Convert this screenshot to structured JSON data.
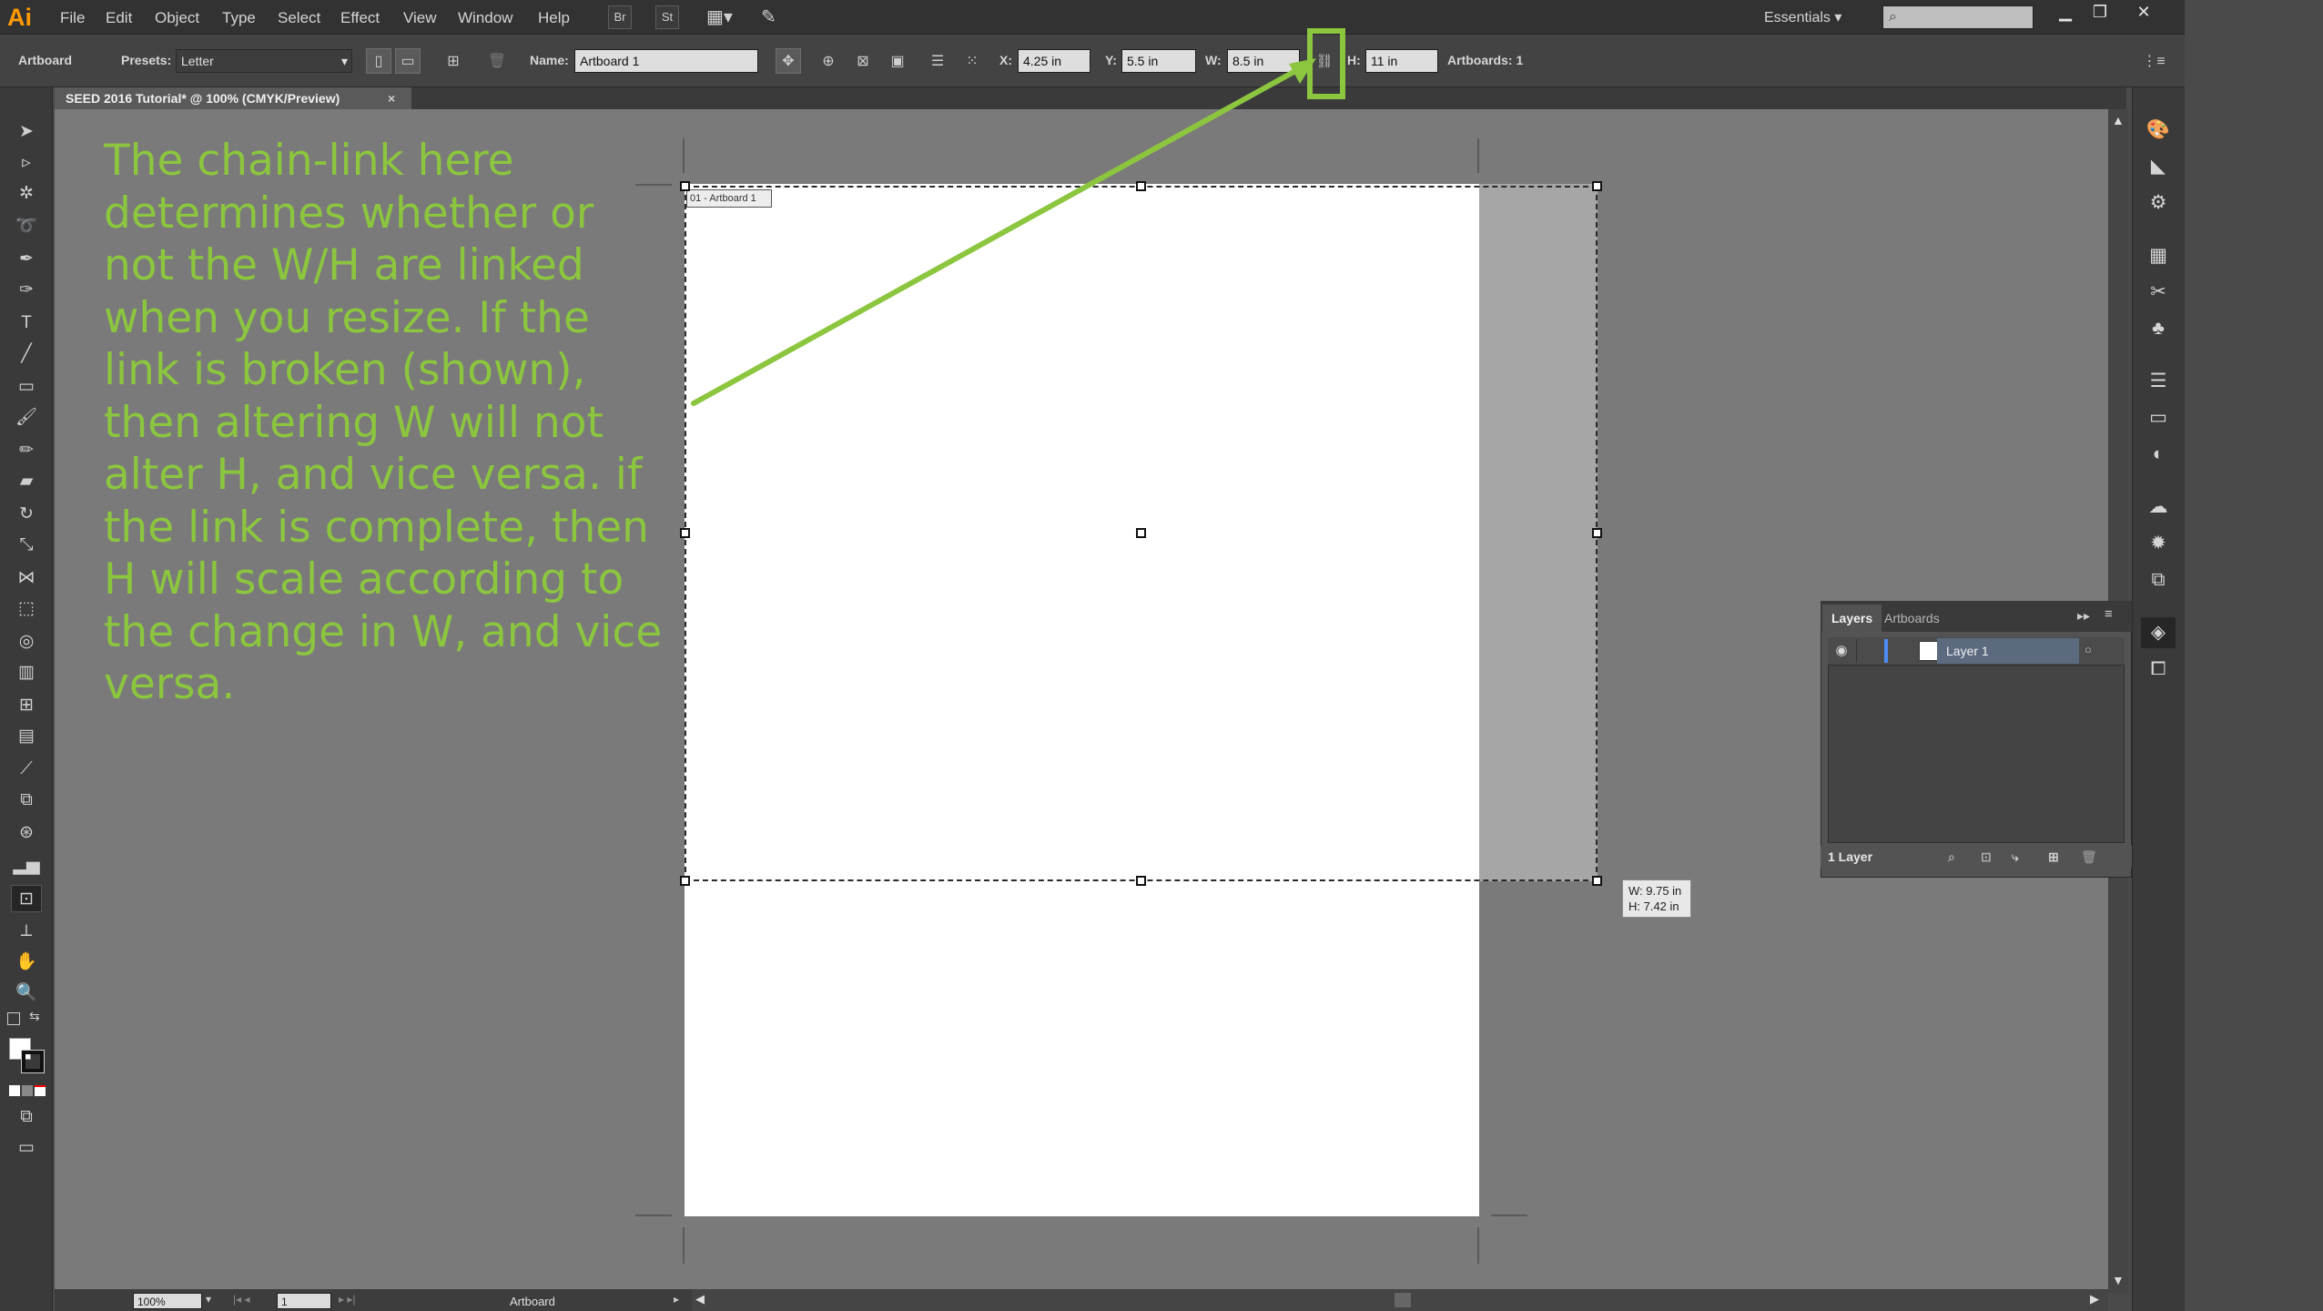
{
  "app": {
    "logo": "Ai"
  },
  "menubar": {
    "items": [
      "File",
      "Edit",
      "Object",
      "Type",
      "Select",
      "Effect",
      "View",
      "Window",
      "Help"
    ],
    "bridge_label": "Br",
    "stock_label": "St",
    "workspace": "Essentials",
    "search_placeholder": ""
  },
  "control_bar": {
    "tool_name": "Artboard",
    "presets_label": "Presets:",
    "preset_value": "Letter",
    "name_label": "Name:",
    "name_value": "Artboard 1",
    "x_label": "X:",
    "x_value": "4.25 in",
    "y_label": "Y:",
    "y_value": "5.5 in",
    "w_label": "W:",
    "w_value": "8.5 in",
    "h_label": "H:",
    "h_value": "11 in",
    "artboards_count": "Artboards: 1"
  },
  "document": {
    "tab_title": "SEED 2016 Tutorial* @ 100% (CMYK/Preview)",
    "tab_close": "×"
  },
  "artboard": {
    "label": "01 - Artboard 1",
    "size_tooltip": {
      "w": "W: 9.75 in",
      "h": "H: 7.42 in"
    }
  },
  "annotation": {
    "text": "The chain-link here determines whether or not the W/H are linked when you resize. If the link is broken (shown), then altering W will not alter H, and vice versa. if the link is complete, then H will scale according to the change in W, and vice versa.",
    "color": "#8cc63f"
  },
  "layers_panel": {
    "tabs": [
      "Layers",
      "Artboards"
    ],
    "layer_name": "Layer 1",
    "footer_count": "1 Layer"
  },
  "status_bar": {
    "zoom": "100%",
    "artboard_number": "1",
    "tool_label": "Artboard"
  },
  "colors": {
    "accent_green": "#8cc63f",
    "logo_orange": "#ff9a00",
    "canvas_gray": "#7a7a7a"
  }
}
